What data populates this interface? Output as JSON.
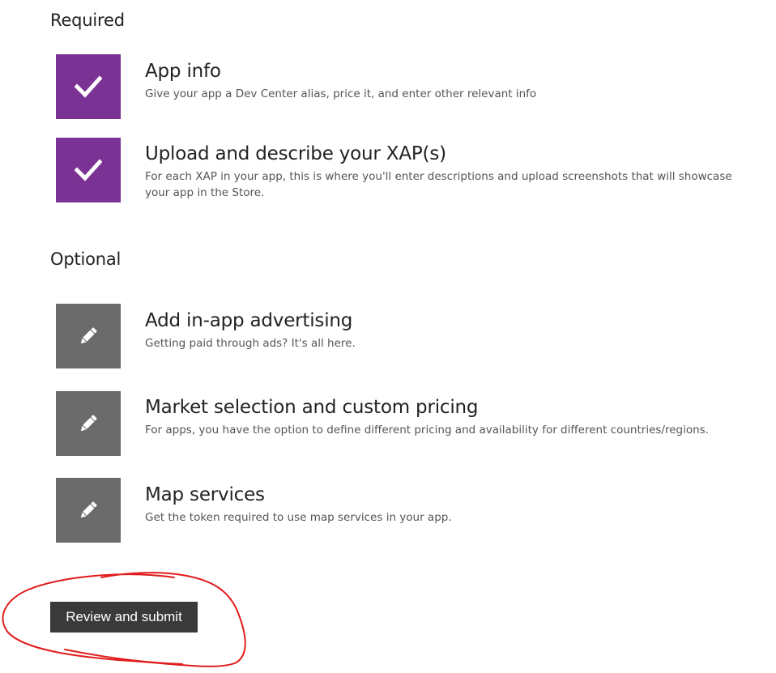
{
  "sections": {
    "required": {
      "heading": "Required",
      "items": [
        {
          "title": "App info",
          "description": "Give your app a Dev Center alias, price it, and enter other relevant info",
          "icon": "check-icon",
          "status": "complete"
        },
        {
          "title": "Upload and describe your XAP(s)",
          "description": "For each XAP in your app, this is where you'll enter descriptions and upload screenshots that will showcase your app in the Store.",
          "icon": "check-icon",
          "status": "complete"
        }
      ]
    },
    "optional": {
      "heading": "Optional",
      "items": [
        {
          "title": "Add in-app advertising",
          "description": "Getting paid through ads? It's all here.",
          "icon": "pencil-icon",
          "status": "editable"
        },
        {
          "title": "Market selection and custom pricing",
          "description": "For apps, you have the option to define different pricing and availability for different countries/regions.",
          "icon": "pencil-icon",
          "status": "editable"
        },
        {
          "title": "Map services",
          "description": "Get the token required to use map services in your app.",
          "icon": "pencil-icon",
          "status": "editable"
        }
      ]
    }
  },
  "submit_button": {
    "label": "Review and submit"
  },
  "colors": {
    "complete_tile": "#7a3294",
    "editable_tile": "#6b6b6b",
    "button_bg": "#3a3a3a",
    "annotation_stroke": "#e01b1b"
  }
}
